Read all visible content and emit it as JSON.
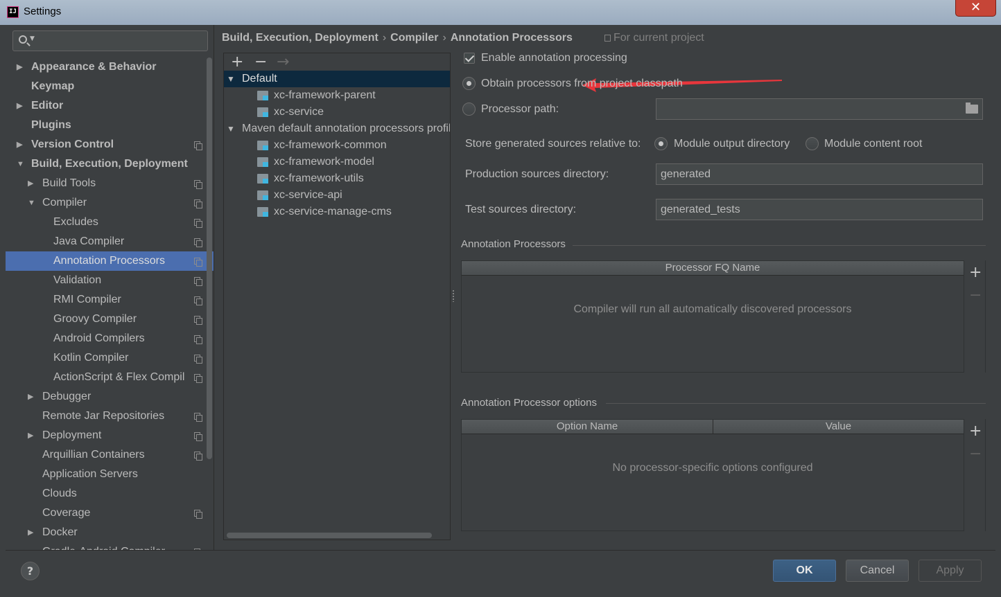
{
  "window": {
    "title": "Settings",
    "close_label": "✕"
  },
  "search": {
    "placeholder": ""
  },
  "sidebar": {
    "items": [
      {
        "label": "Appearance & Behavior",
        "level": 0,
        "bold": true,
        "arrow": "right",
        "copy": false,
        "selected": false
      },
      {
        "label": "Keymap",
        "level": 0,
        "bold": true,
        "arrow": "",
        "copy": false,
        "selected": false
      },
      {
        "label": "Editor",
        "level": 0,
        "bold": true,
        "arrow": "right",
        "copy": false,
        "selected": false
      },
      {
        "label": "Plugins",
        "level": 0,
        "bold": true,
        "arrow": "",
        "copy": false,
        "selected": false
      },
      {
        "label": "Version Control",
        "level": 0,
        "bold": true,
        "arrow": "right",
        "copy": true,
        "selected": false
      },
      {
        "label": "Build, Execution, Deployment",
        "level": 0,
        "bold": true,
        "arrow": "down",
        "copy": false,
        "selected": false
      },
      {
        "label": "Build Tools",
        "level": 1,
        "bold": false,
        "arrow": "right",
        "copy": true,
        "selected": false
      },
      {
        "label": "Compiler",
        "level": 1,
        "bold": false,
        "arrow": "down",
        "copy": true,
        "selected": false
      },
      {
        "label": "Excludes",
        "level": 2,
        "bold": false,
        "arrow": "",
        "copy": true,
        "selected": false
      },
      {
        "label": "Java Compiler",
        "level": 2,
        "bold": false,
        "arrow": "",
        "copy": true,
        "selected": false
      },
      {
        "label": "Annotation Processors",
        "level": 2,
        "bold": false,
        "arrow": "",
        "copy": true,
        "selected": true
      },
      {
        "label": "Validation",
        "level": 2,
        "bold": false,
        "arrow": "",
        "copy": true,
        "selected": false
      },
      {
        "label": "RMI Compiler",
        "level": 2,
        "bold": false,
        "arrow": "",
        "copy": true,
        "selected": false
      },
      {
        "label": "Groovy Compiler",
        "level": 2,
        "bold": false,
        "arrow": "",
        "copy": true,
        "selected": false
      },
      {
        "label": "Android Compilers",
        "level": 2,
        "bold": false,
        "arrow": "",
        "copy": true,
        "selected": false
      },
      {
        "label": "Kotlin Compiler",
        "level": 2,
        "bold": false,
        "arrow": "",
        "copy": true,
        "selected": false
      },
      {
        "label": "ActionScript & Flex Compil",
        "level": 2,
        "bold": false,
        "arrow": "",
        "copy": true,
        "selected": false
      },
      {
        "label": "Debugger",
        "level": 1,
        "bold": false,
        "arrow": "right",
        "copy": false,
        "selected": false
      },
      {
        "label": "Remote Jar Repositories",
        "level": 1,
        "bold": false,
        "arrow": "",
        "copy": true,
        "selected": false
      },
      {
        "label": "Deployment",
        "level": 1,
        "bold": false,
        "arrow": "right",
        "copy": true,
        "selected": false
      },
      {
        "label": "Arquillian Containers",
        "level": 1,
        "bold": false,
        "arrow": "",
        "copy": true,
        "selected": false
      },
      {
        "label": "Application Servers",
        "level": 1,
        "bold": false,
        "arrow": "",
        "copy": false,
        "selected": false
      },
      {
        "label": "Clouds",
        "level": 1,
        "bold": false,
        "arrow": "",
        "copy": false,
        "selected": false
      },
      {
        "label": "Coverage",
        "level": 1,
        "bold": false,
        "arrow": "",
        "copy": true,
        "selected": false
      },
      {
        "label": "Docker",
        "level": 1,
        "bold": false,
        "arrow": "right",
        "copy": false,
        "selected": false
      },
      {
        "label": "Gradle-Android Compiler",
        "level": 1,
        "bold": false,
        "arrow": "",
        "copy": true,
        "selected": false
      }
    ]
  },
  "breadcrumb": {
    "part1": "Build, Execution, Deployment",
    "part2": "Compiler",
    "part3": "Annotation Processors",
    "sep": "›"
  },
  "scope": {
    "label": "For current project"
  },
  "profiles": {
    "toolbar": {
      "add": "+",
      "remove": "−",
      "move": "→"
    },
    "rows": [
      {
        "label": "Default",
        "kind": "group",
        "selected": true
      },
      {
        "label": "xc-framework-parent",
        "kind": "module",
        "selected": false
      },
      {
        "label": "xc-service",
        "kind": "module",
        "selected": false
      },
      {
        "label": "Maven default annotation processors profile",
        "kind": "group",
        "selected": false
      },
      {
        "label": "xc-framework-common",
        "kind": "module",
        "selected": false
      },
      {
        "label": "xc-framework-model",
        "kind": "module",
        "selected": false
      },
      {
        "label": "xc-framework-utils",
        "kind": "module",
        "selected": false
      },
      {
        "label": "xc-service-api",
        "kind": "module",
        "selected": false
      },
      {
        "label": "xc-service-manage-cms",
        "kind": "module",
        "selected": false
      }
    ]
  },
  "settings": {
    "enable_label": "Enable annotation processing",
    "enable_checked": true,
    "obtain_label": "Obtain processors from project classpath",
    "processor_path_label": "Processor path:",
    "processor_path_value": "",
    "store_label": "Store generated sources relative to:",
    "store_opt1": "Module output directory",
    "store_opt2": "Module content root",
    "prod_label": "Production sources directory:",
    "prod_value": "generated",
    "test_label": "Test sources directory:",
    "test_value": "generated_tests"
  },
  "processors_group": {
    "title": "Annotation Processors",
    "column": "Processor FQ Name",
    "empty_text": "Compiler will run all automatically discovered processors",
    "add": "+",
    "remove": "−"
  },
  "options_group": {
    "title": "Annotation Processor options",
    "col1": "Option Name",
    "col2": "Value",
    "empty_text": "No processor-specific options configured",
    "add": "+",
    "remove": "−"
  },
  "footer": {
    "help": "?",
    "ok": "OK",
    "cancel": "Cancel",
    "apply": "Apply"
  },
  "colors": {
    "accent": "#4b6eaf",
    "annotation_arrow": "#e8363c",
    "background": "#3c3f41"
  }
}
